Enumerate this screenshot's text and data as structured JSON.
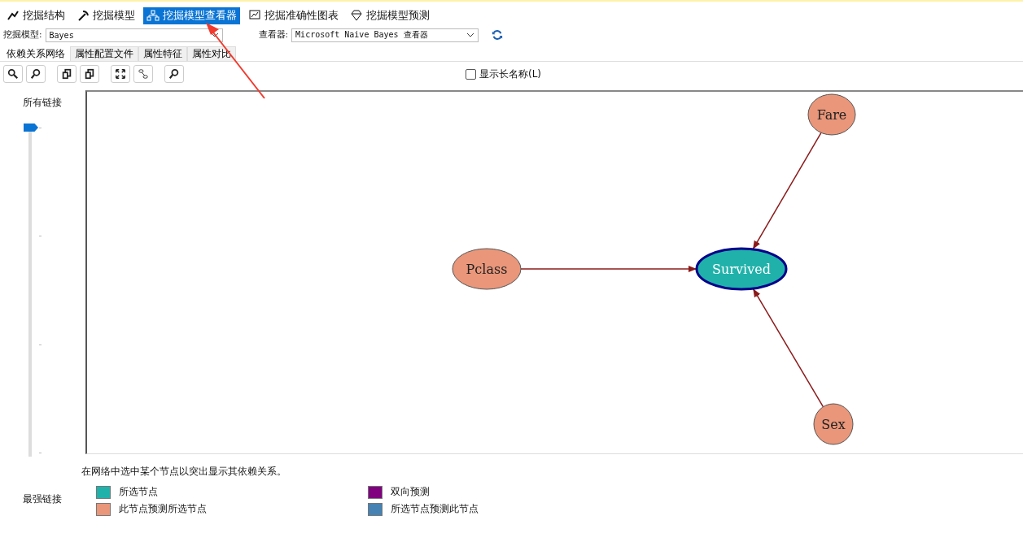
{
  "toolbar": [
    {
      "label": "挖掘结构",
      "selected": false
    },
    {
      "label": "挖掘模型",
      "selected": false
    },
    {
      "label": "挖掘模型查看器",
      "selected": true
    },
    {
      "label": "挖掘准确性图表",
      "selected": false
    },
    {
      "label": "挖掘模型预测",
      "selected": false
    }
  ],
  "model_select": {
    "label": "挖掘模型:",
    "value": "Bayes"
  },
  "viewer_select": {
    "label": "查看器:",
    "value": "Microsoft Naive Bayes 查看器"
  },
  "tabs": [
    {
      "label": "依赖关系网络",
      "selected": true
    },
    {
      "label": "属性配置文件",
      "selected": false
    },
    {
      "label": "属性特征",
      "selected": false
    },
    {
      "label": "属性对比",
      "selected": false
    }
  ],
  "show_long_names": {
    "label": "显示长名称(L)",
    "checked": false
  },
  "link_slider": {
    "top_label": "所有链接",
    "bottom_label": "最强链接",
    "level": 0
  },
  "nodes": [
    {
      "name": "Fare",
      "selected": false
    },
    {
      "name": "Pclass",
      "selected": false
    },
    {
      "name": "Survived",
      "selected": true
    },
    {
      "name": "Sex",
      "selected": false
    }
  ],
  "hint": "在网络中选中某个节点以突出显示其依赖关系。",
  "legend": [
    {
      "label": "所选节点",
      "color": "#20b2aa"
    },
    {
      "label": "双向预测",
      "color": "#800080"
    },
    {
      "label": "此节点预测所选节点",
      "color": "#e9967a"
    },
    {
      "label": "所选节点预测此节点",
      "color": "#4682b4"
    }
  ]
}
